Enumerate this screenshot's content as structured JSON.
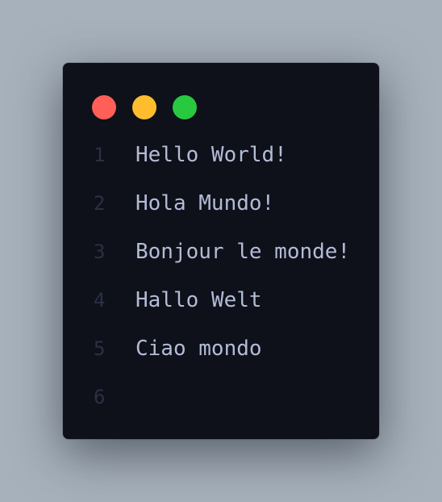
{
  "window": {
    "colors": {
      "close": "#ff5f57",
      "minimize": "#ffbd2e",
      "maximize": "#28c840",
      "line_number": "#2a3142",
      "code_text": "#b4bbd6",
      "background": "#0e111a"
    },
    "lines": [
      {
        "number": "1",
        "text": "Hello World!"
      },
      {
        "number": "2",
        "text": "Hola Mundo!"
      },
      {
        "number": "3",
        "text": "Bonjour le monde!"
      },
      {
        "number": "4",
        "text": "Hallo Welt"
      },
      {
        "number": "5",
        "text": "Ciao mondo"
      },
      {
        "number": "6",
        "text": ""
      }
    ]
  }
}
